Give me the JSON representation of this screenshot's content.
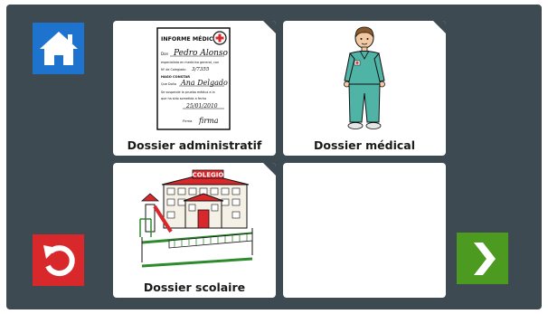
{
  "navigation": {
    "home_icon": "home-icon",
    "back_icon": "undo-arrow-icon",
    "next_icon": "chevron-right-icon",
    "colors": {
      "home": "#1e73cf",
      "back": "#d8282c",
      "next": "#4c9a1f",
      "background": "#3e4a52"
    }
  },
  "cards": {
    "admin": {
      "label": "Dossier administratif",
      "pictogram": "medical-report-document-icon"
    },
    "medical": {
      "label": "Dossier médical",
      "pictogram": "doctor-figure-icon"
    },
    "school": {
      "label": "Dossier scolaire",
      "pictogram": "school-building-icon"
    },
    "empty": {
      "label": ""
    }
  },
  "report_doc": {
    "heading": "INFORME MÉDICO",
    "line_don": "Don",
    "sig_name": "Pedro Alonso",
    "line_2": "especialista en medicina general, con",
    "line_3": "Nº de Colegiado",
    "number": "3/7355",
    "line_4": "HAGO CONSTAR",
    "line_5": "Que Doña",
    "sig_patient": "Ana Delgado",
    "line_6": "Se suspende la prueba médica a la",
    "line_7": "que ha sido sometida a fecha",
    "date": "25/01/2010",
    "firma": "Firma",
    "signature": "firma"
  },
  "school_sign": "COLEGIO"
}
